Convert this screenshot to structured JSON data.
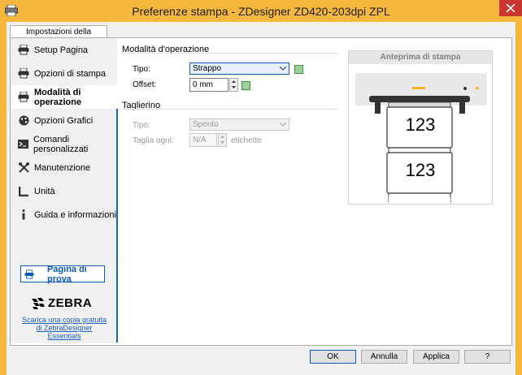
{
  "window": {
    "title": "Preferenze stampa - ZDesigner ZD420-203dpi ZPL"
  },
  "tabs": [
    {
      "label": "Impostazioni della stampante"
    }
  ],
  "sidebar": {
    "items": [
      {
        "label": "Setup Pagina",
        "icon": "printer-setup-icon"
      },
      {
        "label": "Opzioni di stampa",
        "icon": "printer-options-icon"
      },
      {
        "label": "Modalità di operazione",
        "icon": "printer-mode-icon",
        "active": true
      },
      {
        "label": "Opzioni Grafici",
        "icon": "graphics-icon"
      },
      {
        "label": "Comandi personalizzati",
        "icon": "terminal-icon"
      },
      {
        "label": "Manutenzione",
        "icon": "tools-icon"
      },
      {
        "label": "Unità",
        "icon": "ruler-icon"
      },
      {
        "label": "Guida e informazioni",
        "icon": "info-icon"
      }
    ],
    "test_button": "Pagina di prova",
    "logo_text": "ZEBRA",
    "promo_lines": [
      "Scarica una copia gratuita",
      "di ZebraDesigner",
      "Essentials"
    ]
  },
  "operation": {
    "section_title": "Modalità d'operazione",
    "tipo_label": "Tipo:",
    "tipo_value": "Strappo",
    "offset_label": "Offset:",
    "offset_value": "0 mm"
  },
  "cutter": {
    "section_title": "Taglierino",
    "tipo_label": "Tipo:",
    "tipo_value": "Spento",
    "taglia_label": "Taglia ogni:",
    "taglia_value": "N/A",
    "taglia_unit": "etichette"
  },
  "preview": {
    "title": "Anteprima di stampa",
    "label_1": "123",
    "label_2": "123"
  },
  "buttons": {
    "ok": "OK",
    "cancel": "Annulla",
    "apply": "Applica",
    "help": "?"
  },
  "colors": {
    "title_bar": "#f5b73e",
    "accent": "#0a5ab6",
    "close": "#c7372f"
  }
}
